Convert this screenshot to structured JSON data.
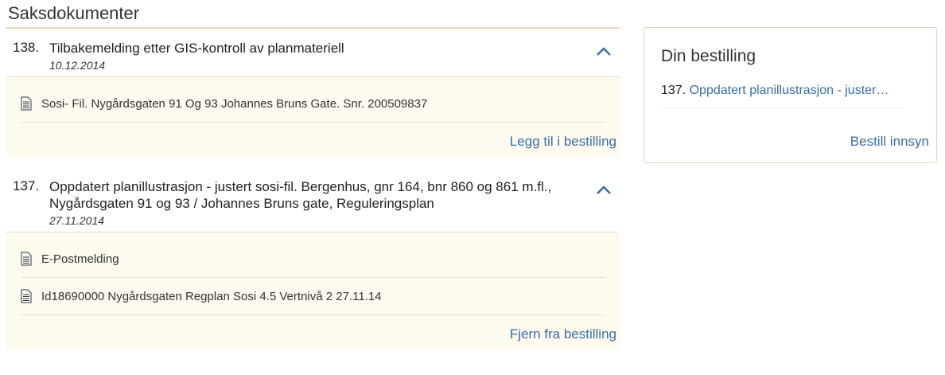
{
  "section": {
    "title": "Saksdokumenter"
  },
  "cases": [
    {
      "number": "138.",
      "title": "Tilbakemelding etter GIS-kontroll av planmateriell",
      "date": "10.12.2014",
      "documents": [
        {
          "label": "Sosi- Fil. Nygårdsgaten 91 Og 93 Johannes Bruns Gate. Snr. 200509837"
        }
      ],
      "action_label": "Legg til i bestilling"
    },
    {
      "number": "137.",
      "title": "Oppdatert planillustrasjon - justert sosi-fil. Bergenhus, gnr 164, bnr 860 og 861 m.fl., Nygårdsgaten 91 og 93 / Johannes Bruns gate, Reguleringsplan",
      "date": "27.11.2014",
      "documents": [
        {
          "label": "E-Postmelding"
        },
        {
          "label": "Id18690000 Nygårdsgaten Regplan Sosi 4.5 Vertnivå 2 27.11.14"
        }
      ],
      "action_label": "Fjern fra bestilling"
    }
  ],
  "order": {
    "title": "Din bestilling",
    "items": [
      {
        "number": "137.",
        "label": "Oppdatert planillustrasjon - juster…"
      }
    ],
    "submit_label": "Bestill innsyn"
  },
  "colors": {
    "accent": "#3a6ea5",
    "panel": "#fdfaf0",
    "rule": "#e8d9b5"
  },
  "icons": {
    "collapse": "chevron-up-icon",
    "document": "document-icon"
  }
}
